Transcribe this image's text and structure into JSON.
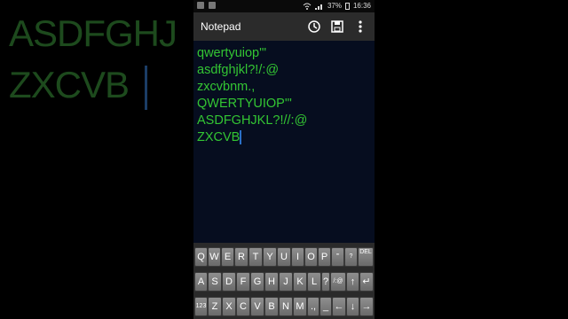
{
  "background_echo": {
    "line1": "ASDFGHJ",
    "line2": "ZXCVB"
  },
  "status_bar": {
    "battery": "37%",
    "time": "16:36"
  },
  "app": {
    "title": "Notepad"
  },
  "editor": {
    "lines": [
      "qwertyuiop'\"",
      "asdfghjkl?!/:@",
      "zxcvbnm.,",
      "QWERTYUIOP'\"",
      "ASDFGHJKL?!//:@",
      "ZXCVB"
    ]
  },
  "keyboard": {
    "row1": [
      "Q",
      "W",
      "E",
      "R",
      "T",
      "Y",
      "U",
      "I",
      "O",
      "P",
      "'\"",
      "?",
      "DEL"
    ],
    "row2": [
      "A",
      "S",
      "D",
      "F",
      "G",
      "H",
      "J",
      "K",
      "L",
      "?",
      "/:@",
      "↑",
      "↵"
    ],
    "row3": [
      "123",
      "Z",
      "X",
      "C",
      "V",
      "B",
      "N",
      "M",
      ".,",
      "_",
      "←",
      "↓",
      "→"
    ]
  },
  "colors": {
    "text_green": "#33c533",
    "editor_bg": "#060d1f",
    "caret_blue": "#2a6fc7"
  }
}
